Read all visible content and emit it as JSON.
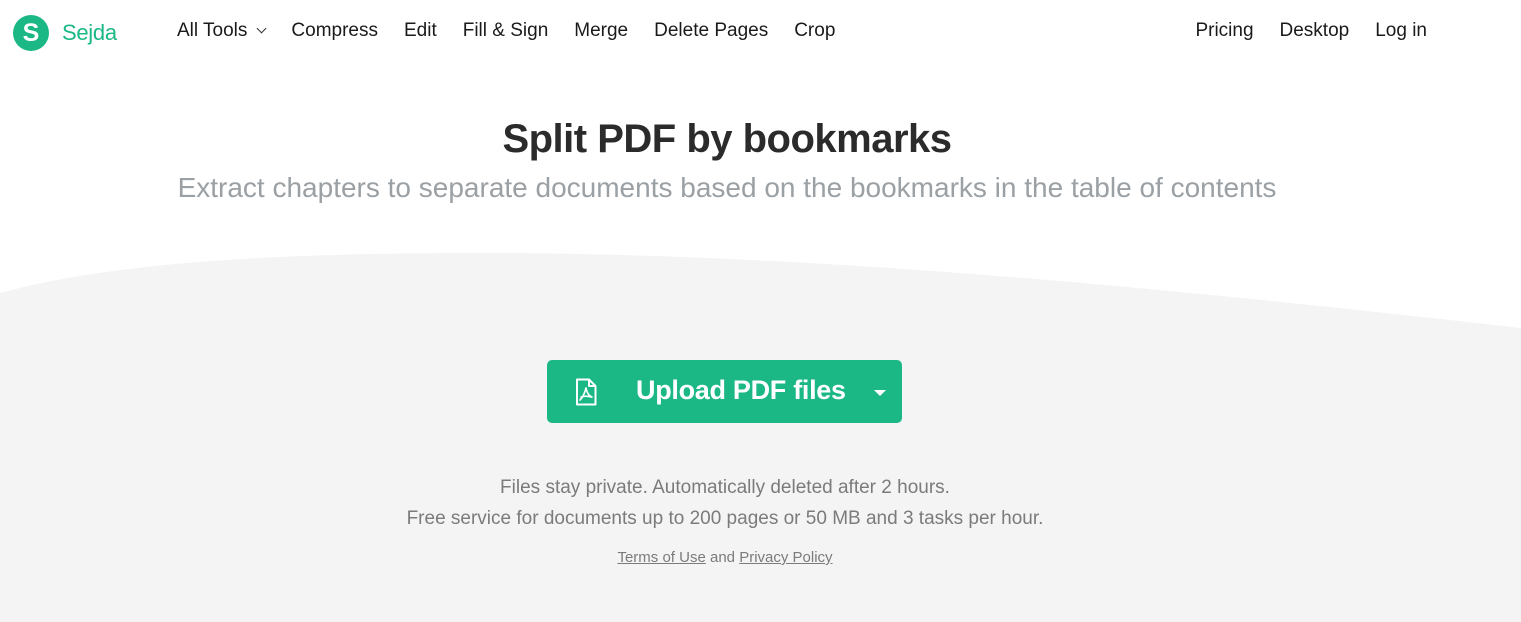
{
  "brand": {
    "name": "Sejda",
    "logo_letter": "S",
    "color": "#1bb886"
  },
  "nav": {
    "items": [
      {
        "label": "All Tools",
        "has_dropdown": true
      },
      {
        "label": "Compress"
      },
      {
        "label": "Edit"
      },
      {
        "label": "Fill & Sign"
      },
      {
        "label": "Merge"
      },
      {
        "label": "Delete Pages"
      },
      {
        "label": "Crop"
      }
    ],
    "right_items": [
      {
        "label": "Pricing"
      },
      {
        "label": "Desktop"
      },
      {
        "label": "Log in"
      }
    ]
  },
  "hero": {
    "title": "Split PDF by bookmarks",
    "subtitle": "Extract chapters to separate documents based on the bookmarks in the table of contents"
  },
  "upload": {
    "label": "Upload PDF files",
    "icon": "pdf-file-icon",
    "dropdown_icon": "caret-down-icon",
    "color": "#1bb886"
  },
  "notes": {
    "line1": "Files stay private. Automatically deleted after 2 hours.",
    "line2": "Free service for documents up to 200 pages or 50 MB and 3 tasks per hour."
  },
  "legal": {
    "terms_label": "Terms of Use",
    "and_label": "and",
    "privacy_label": "Privacy Policy"
  },
  "colors": {
    "background_wave": "#f4f4f4",
    "title": "#2b2b2b",
    "subtitle": "#9aa0a4",
    "note": "#7b7b7b"
  }
}
